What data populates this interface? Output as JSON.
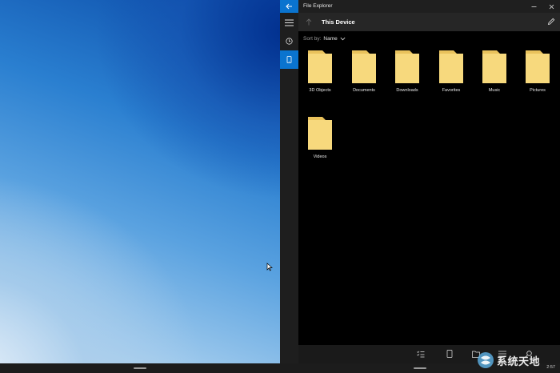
{
  "window": {
    "title": "File Explorer"
  },
  "header": {
    "location": "This Device"
  },
  "sortbar": {
    "label": "Sort by:",
    "value": "Name"
  },
  "folders": [
    {
      "name": "3D Objects"
    },
    {
      "name": "Documents"
    },
    {
      "name": "Downloads"
    },
    {
      "name": "Favorites"
    },
    {
      "name": "Music"
    },
    {
      "name": "Pictures"
    },
    {
      "name": "Videos"
    }
  ],
  "taskbar": {
    "clock": "2:57"
  },
  "watermark": {
    "text": "系统天地"
  },
  "colors": {
    "accent": "#0a74cf",
    "folder": "#f7d97d",
    "folder_tab": "#e9c25c"
  }
}
